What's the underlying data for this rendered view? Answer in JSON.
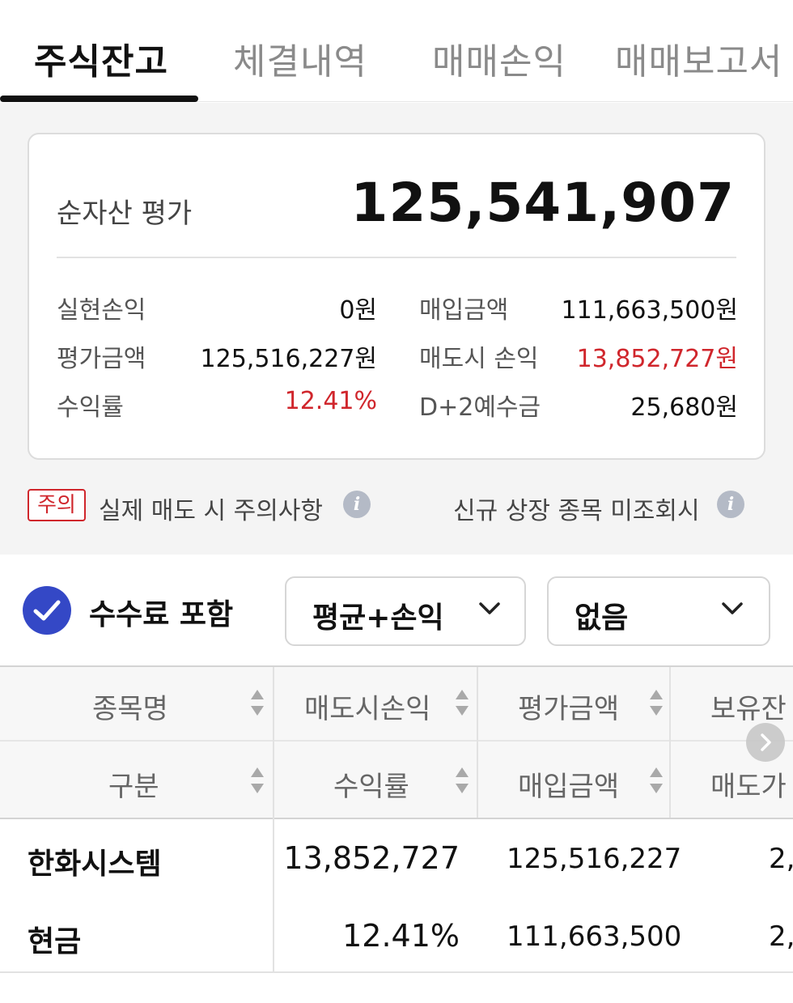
{
  "tabs": [
    {
      "label": "주식잔고",
      "active": true
    },
    {
      "label": "체결내역",
      "active": false
    },
    {
      "label": "매매손익",
      "active": false
    },
    {
      "label": "매매보고서",
      "active": false
    }
  ],
  "summary": {
    "net_asset_label": "순자산 평가",
    "net_asset_value": "125,541,907",
    "realized_pl_label": "실현손익",
    "realized_pl_value": "0원",
    "purchase_amount_label": "매입금액",
    "purchase_amount_value": "111,663,500원",
    "eval_amount_label": "평가금액",
    "eval_amount_value": "125,516,227원",
    "sell_pl_label": "매도시 손익",
    "sell_pl_value": "13,852,727원",
    "return_label": "수익률",
    "return_value": "12.41%",
    "d2_label": "D+2예수금",
    "d2_value": "25,680원"
  },
  "notice": {
    "badge": "주의",
    "caution_text": "실제 매도 시 주의사항",
    "new_listing_text": "신규 상장 종목 미조회시",
    "info_glyph": "i"
  },
  "filters": {
    "include_fee_label": "수수료 포함",
    "include_fee_checked": true,
    "view_select": "평균+손익",
    "option_select": "없음"
  },
  "table": {
    "header_row1": [
      "종목명",
      "매도시손익",
      "평가금액",
      "보유잔"
    ],
    "header_row2": [
      "구분",
      "수익률",
      "매입금액",
      "매도가"
    ],
    "rows": [
      {
        "c1": "한화시스템",
        "c2": "13,852,727",
        "c3": "125,516,227",
        "c4": "2,"
      },
      {
        "c1": "현금",
        "c2": "12.41%",
        "c3": "111,663,500",
        "c4": "2,"
      }
    ]
  },
  "colors": {
    "accent": "#3448c6",
    "loss_profit_red": "#d0262c",
    "text": "#111111",
    "muted": "#8a8a8a"
  }
}
